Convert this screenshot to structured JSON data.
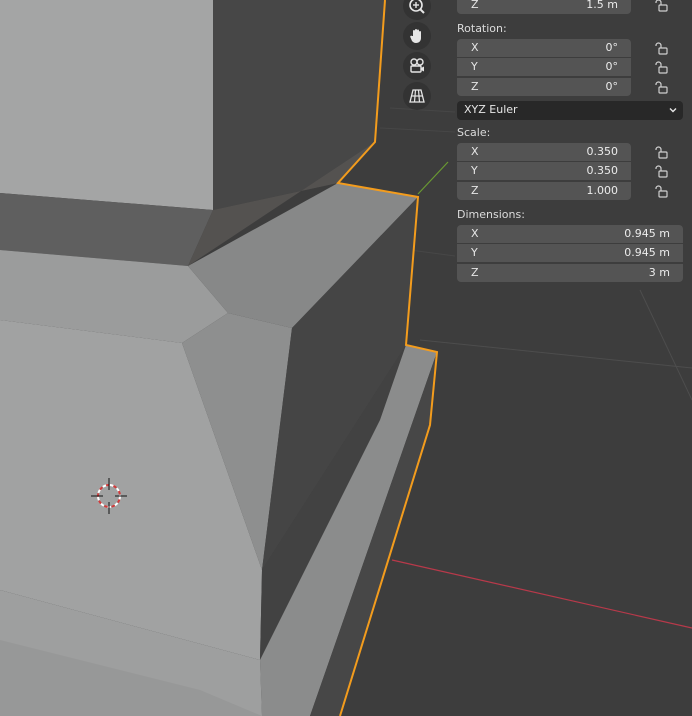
{
  "panel": {
    "location_partial": {
      "axis": "Z",
      "value": "1.5 m"
    },
    "rotation": {
      "label": "Rotation:",
      "x": {
        "axis": "X",
        "value": "0°"
      },
      "y": {
        "axis": "Y",
        "value": "0°"
      },
      "z": {
        "axis": "Z",
        "value": "0°"
      },
      "mode": "XYZ Euler"
    },
    "scale": {
      "label": "Scale:",
      "x": {
        "axis": "X",
        "value": "0.350"
      },
      "y": {
        "axis": "Y",
        "value": "0.350"
      },
      "z": {
        "axis": "Z",
        "value": "1.000"
      }
    },
    "dimensions": {
      "label": "Dimensions:",
      "x": {
        "axis": "X",
        "value": "0.945 m"
      },
      "y": {
        "axis": "Y",
        "value": "0.945 m"
      },
      "z": {
        "axis": "Z",
        "value": "3 m"
      }
    }
  },
  "navigation": {
    "icons": [
      "zoom-icon",
      "hand-pan-icon",
      "camera-view-icon",
      "perspective-grid-icon"
    ]
  },
  "colors": {
    "viewport_bg": "#3d3d3d",
    "selection_outline": "#f39c1d",
    "x_axis_line": "#b8394a",
    "y_axis_line": "#6a9a32",
    "field_bg": "#545454",
    "dropdown_bg": "#282828"
  }
}
